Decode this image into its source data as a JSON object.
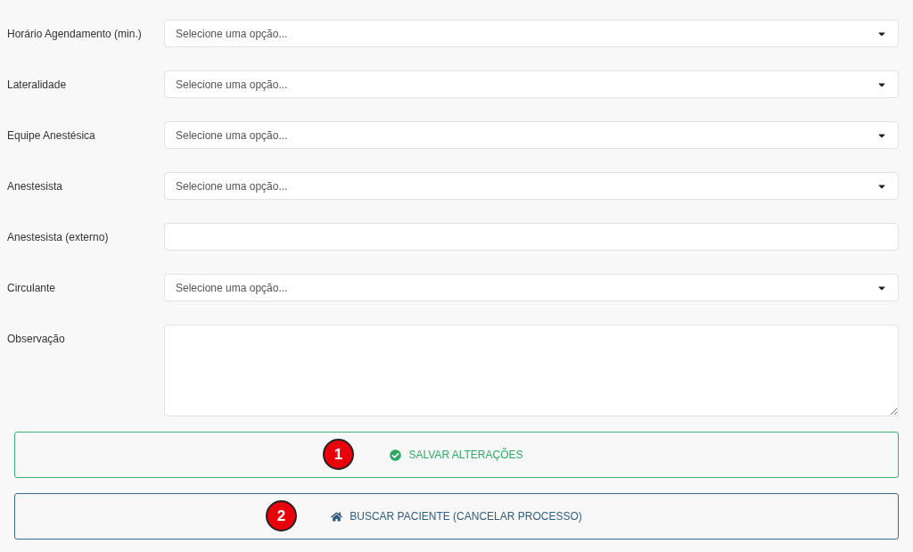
{
  "fields": [
    {
      "label": "Horário Agendamento (min.)",
      "kind": "select",
      "placeholder": "Selecione uma opção..."
    },
    {
      "label": "Lateralidade",
      "kind": "select",
      "placeholder": "Selecione uma opção..."
    },
    {
      "label": "Equipe Anestésica",
      "kind": "select",
      "placeholder": "Selecione uma opção..."
    },
    {
      "label": "Anestesista",
      "kind": "select",
      "placeholder": "Selecione uma opção..."
    },
    {
      "label": "Anestesista (externo)",
      "kind": "text"
    },
    {
      "label": "Circulante",
      "kind": "select",
      "placeholder": "Selecione uma opção..."
    },
    {
      "label": "Observação",
      "kind": "textarea"
    }
  ],
  "buttons": [
    {
      "kind": "save",
      "label": "SALVAR ALTERAÇÕES",
      "badge": "1"
    },
    {
      "kind": "home",
      "label": "BUSCAR PACIENTE (CANCELAR PROCESSO)",
      "badge": "2"
    }
  ]
}
